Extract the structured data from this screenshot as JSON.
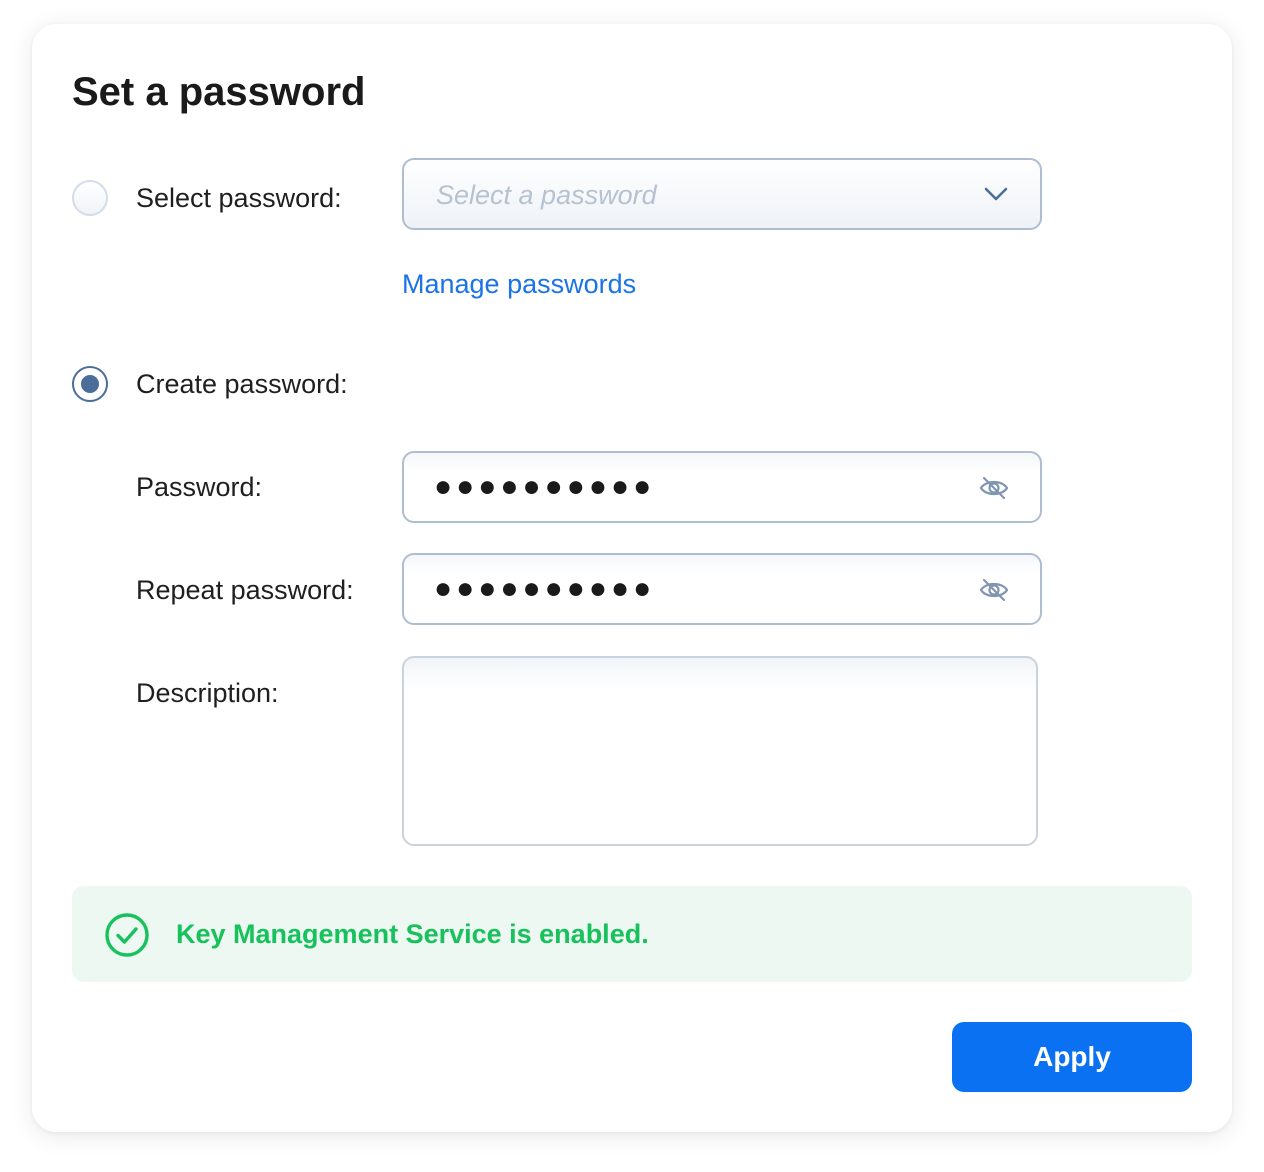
{
  "dialog": {
    "title": "Set a password"
  },
  "select_option": {
    "label": "Select password:",
    "selected": false,
    "placeholder": "Select a password",
    "link": "Manage passwords"
  },
  "create_option": {
    "label": "Create password:",
    "selected": true,
    "password_label": "Password:",
    "password_value": "●●●●●●●●●●",
    "repeat_label": "Repeat password:",
    "repeat_value": "●●●●●●●●●●",
    "description_label": "Description:",
    "description_value": ""
  },
  "status": {
    "message": "Key Management Service is enabled.",
    "icon": "check-circle-icon",
    "color": "#17c15c",
    "background": "#ecf8f1"
  },
  "actions": {
    "apply_label": "Apply",
    "accent": "#0a71f2"
  },
  "icons": {
    "dropdown": "chevron-down-icon",
    "visibility": "eye-slash-icon"
  }
}
